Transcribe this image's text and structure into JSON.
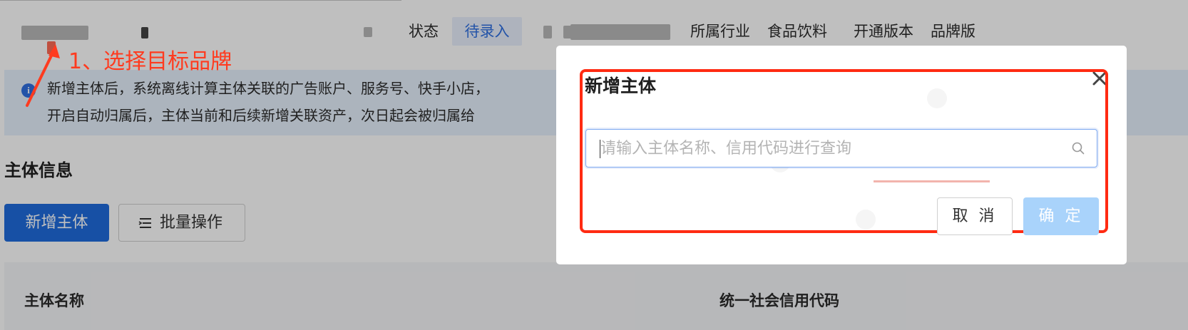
{
  "header": {
    "status_label": "状态",
    "status_value": "待录入",
    "industry_label": "所属行业",
    "industry_value": "食品饮料",
    "version_label": "开通版本",
    "version_value": "品牌版"
  },
  "annotation": {
    "step_text": "1、选择目标品牌",
    "color": "#ff3b1f"
  },
  "info": {
    "icon": "info-icon",
    "line1": "新增主体后，系统离线计算主体关联的广告账户、服务号、快手小店，",
    "line2": "开启自动归属后，主体当前和后续新增关联资产，次日起会被归属给"
  },
  "section": {
    "title": "主体信息",
    "add_button": "新增主体",
    "batch_button": "批量操作",
    "batch_icon": "list-icon"
  },
  "table": {
    "columns": [
      "主体名称",
      "统一社会信用代码"
    ]
  },
  "modal": {
    "title": "新增主体",
    "close_icon": "close-icon",
    "search_value": "",
    "search_placeholder": "请输入主体名称、信用代码进行查询",
    "search_icon": "search-icon",
    "cancel_label": "取 消",
    "ok_label": "确 定"
  },
  "colors": {
    "primary": "#1f6bdc",
    "highlight": "#ff2b12",
    "ok_disabled": "#a9d3fb",
    "info_bg": "#e6f0fc"
  }
}
